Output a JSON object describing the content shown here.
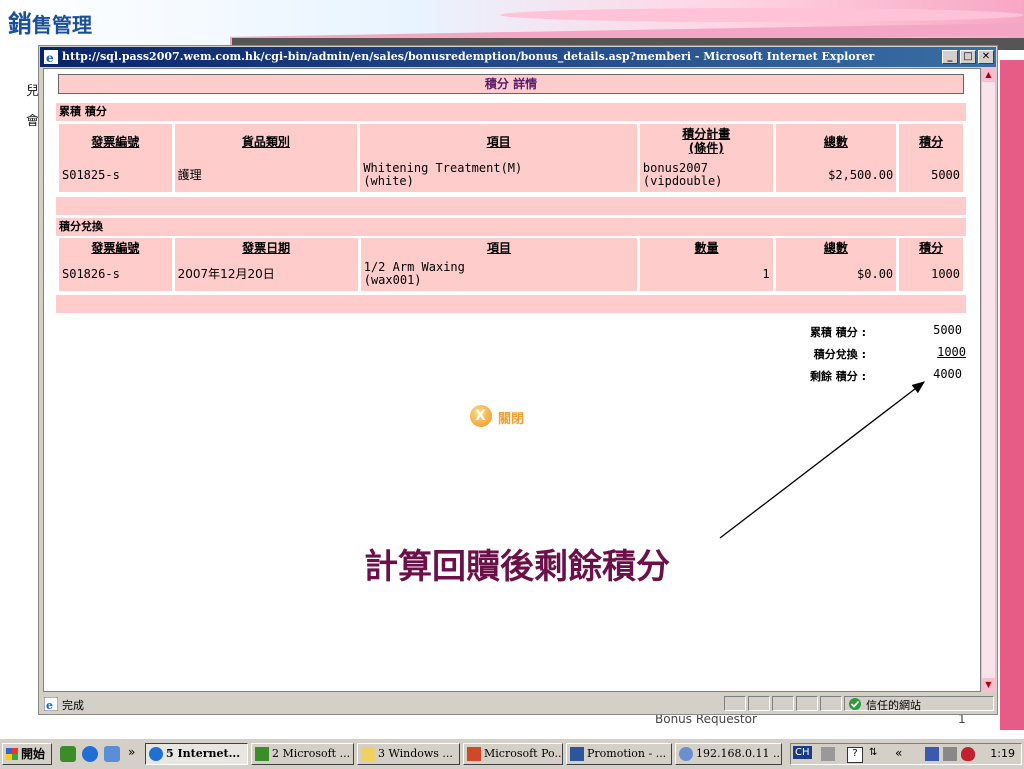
{
  "background": {
    "app_title_main": "銷",
    "app_title_rest": "售管理",
    "left_letters": [
      "兒",
      "會"
    ],
    "bottom_text": "Bonus Requestor",
    "bottom_num": "1"
  },
  "window": {
    "title": "http://sql.pass2007.wem.com.hk/cgi-bin/admin/en/sales/bonusredemption/bonus_details.asp?memberi - Microsoft Internet Explorer",
    "status_text": "完成",
    "zone_text": "信任的網站"
  },
  "page": {
    "header": "積分 詳情",
    "accum_section": {
      "title": "累積 積分",
      "columns": [
        "發票編號",
        "貨品類別",
        "項目",
        "積分計畫\n(條件)",
        "總數",
        "積分"
      ],
      "rows": [
        {
          "invoice": "S01825-s",
          "category": "護理",
          "item_line1": "Whitening Treatment(M)",
          "item_line2": "(white)",
          "plan_line1": "bonus2007",
          "plan_line2": "(vipdouble)",
          "total": "$2,500.00",
          "points": "5000"
        }
      ]
    },
    "redeem_section": {
      "title": "積分兌換",
      "columns": [
        "發票編號",
        "發票日期",
        "項目",
        "數量",
        "總數",
        "積分"
      ],
      "rows": [
        {
          "invoice": "S01826-s",
          "date": "2007年12月20日",
          "item_line1": "1/2 Arm Waxing",
          "item_line2": "(wax001)",
          "qty": "1",
          "total": "$0.00",
          "points": "1000"
        }
      ]
    },
    "summary": {
      "accum_label": "累積 積分 :",
      "accum_value": "5000",
      "redeem_label": "積分兌換 :",
      "redeem_value": "1000",
      "remain_label": "剩餘 積分 :",
      "remain_value": "4000"
    },
    "close_label": "關閉",
    "annotation": "計算回贖後剩餘積分"
  },
  "taskbar": {
    "start_label": "開始",
    "tasks": [
      "5 Internet...",
      "2 Microsoft ...",
      "3 Windows ...",
      "Microsoft Po...",
      "Promotion - ...",
      "192.168.0.11 ..."
    ],
    "lang": "CH",
    "clock": "1:19"
  }
}
